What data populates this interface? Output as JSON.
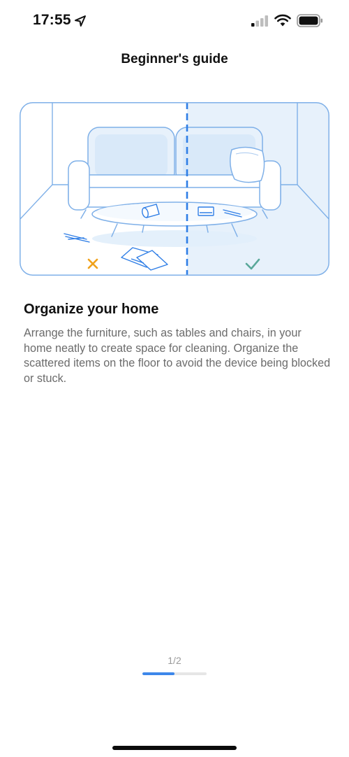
{
  "status_bar": {
    "time": "17:55",
    "icons": [
      "location-arrow-icon",
      "cellular-signal-icon",
      "wifi-icon",
      "battery-icon"
    ]
  },
  "header": {
    "title": "Beginner's guide"
  },
  "illustration": {
    "subject": "living-room-sofa-table",
    "left_marker": "cross-icon",
    "right_marker": "check-icon",
    "colors": {
      "line": "#7fb0e8",
      "fill": "#e7f1fb",
      "divider": "#2f7ee6",
      "cross": "#f0a21c",
      "check": "#5aa89a"
    }
  },
  "content": {
    "heading": "Organize your home",
    "body": "Arrange the furniture, such as tables and chairs, in your home neatly to create space for cleaning. Organize the scattered items on the floor to avoid the device being blocked or stuck."
  },
  "pager": {
    "label": "1/2",
    "progress": 0.5,
    "colors": {
      "fill": "#3d87ea",
      "track": "#e6e6e6"
    }
  }
}
